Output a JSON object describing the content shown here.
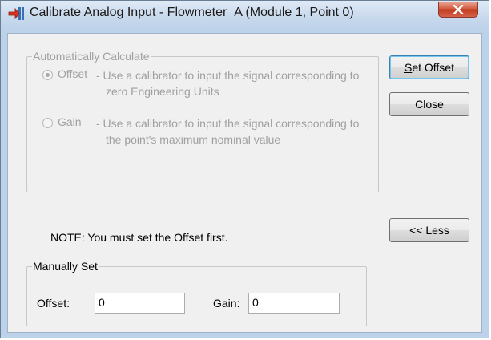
{
  "window": {
    "title": "Calibrate Analog Input - Flowmeter_A (Module 1, Point 0)",
    "app_icon": "calibrate-arrow-icon",
    "close_icon": "close-x-icon",
    "accent_colors": {
      "close_button": "#c94a2f",
      "default_button_border": "#3c7fb1"
    }
  },
  "auto_group": {
    "legend": "Automatically Calculate",
    "options": [
      {
        "label": "Offset",
        "description": "- Use a calibrator to input the signal corresponding to zero Engineering Units",
        "selected": true,
        "enabled": false
      },
      {
        "label": "Gain",
        "description": "- Use a calibrator to input the signal corresponding to the point's maximum nominal value",
        "selected": false,
        "enabled": false
      }
    ]
  },
  "buttons": {
    "set_offset": "Set Offset",
    "close": "Close",
    "less": "<< Less"
  },
  "note": "NOTE: You must set the Offset first.",
  "manual_group": {
    "legend": "Manually Set",
    "offset_label": "Offset:",
    "offset_value": "0",
    "gain_label": "Gain:",
    "gain_value": "0"
  }
}
